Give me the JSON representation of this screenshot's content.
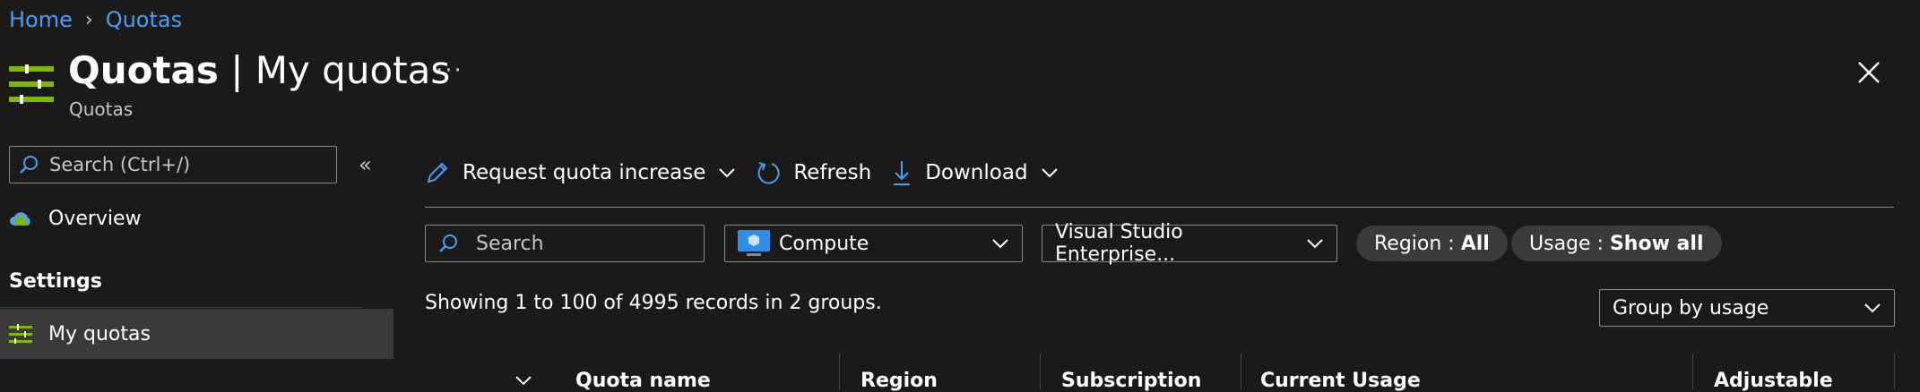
{
  "breadcrumb": {
    "home": "Home",
    "current": "Quotas"
  },
  "header": {
    "title_bold": "Quotas",
    "title_rest": " | My quotas",
    "subtitle": "Quotas",
    "more_label": "···"
  },
  "sidebar": {
    "search_placeholder": "Search (Ctrl+/)",
    "collapse_label": "«",
    "overview_label": "Overview",
    "settings_heading": "Settings",
    "my_quotas_label": "My quotas"
  },
  "toolbar": {
    "request_label": "Request quota increase",
    "refresh_label": "Refresh",
    "download_label": "Download"
  },
  "filters": {
    "search_placeholder": "Search",
    "provider_value": "Compute",
    "subscription_value": "Visual Studio Enterprise...",
    "region_key": "Region : ",
    "region_value": "All",
    "usage_key": "Usage : ",
    "usage_value": "Show all",
    "group_by_value": "Group by usage"
  },
  "records_text": "Showing 1 to 100 of 4995 records in 2 groups.",
  "table": {
    "columns": [
      "Quota name",
      "Region",
      "Subscription",
      "Current Usage",
      "Adjustable"
    ]
  },
  "colors": {
    "accent": "#479ef5",
    "background": "#1b1a19",
    "quota_icon": "#7fba00"
  }
}
